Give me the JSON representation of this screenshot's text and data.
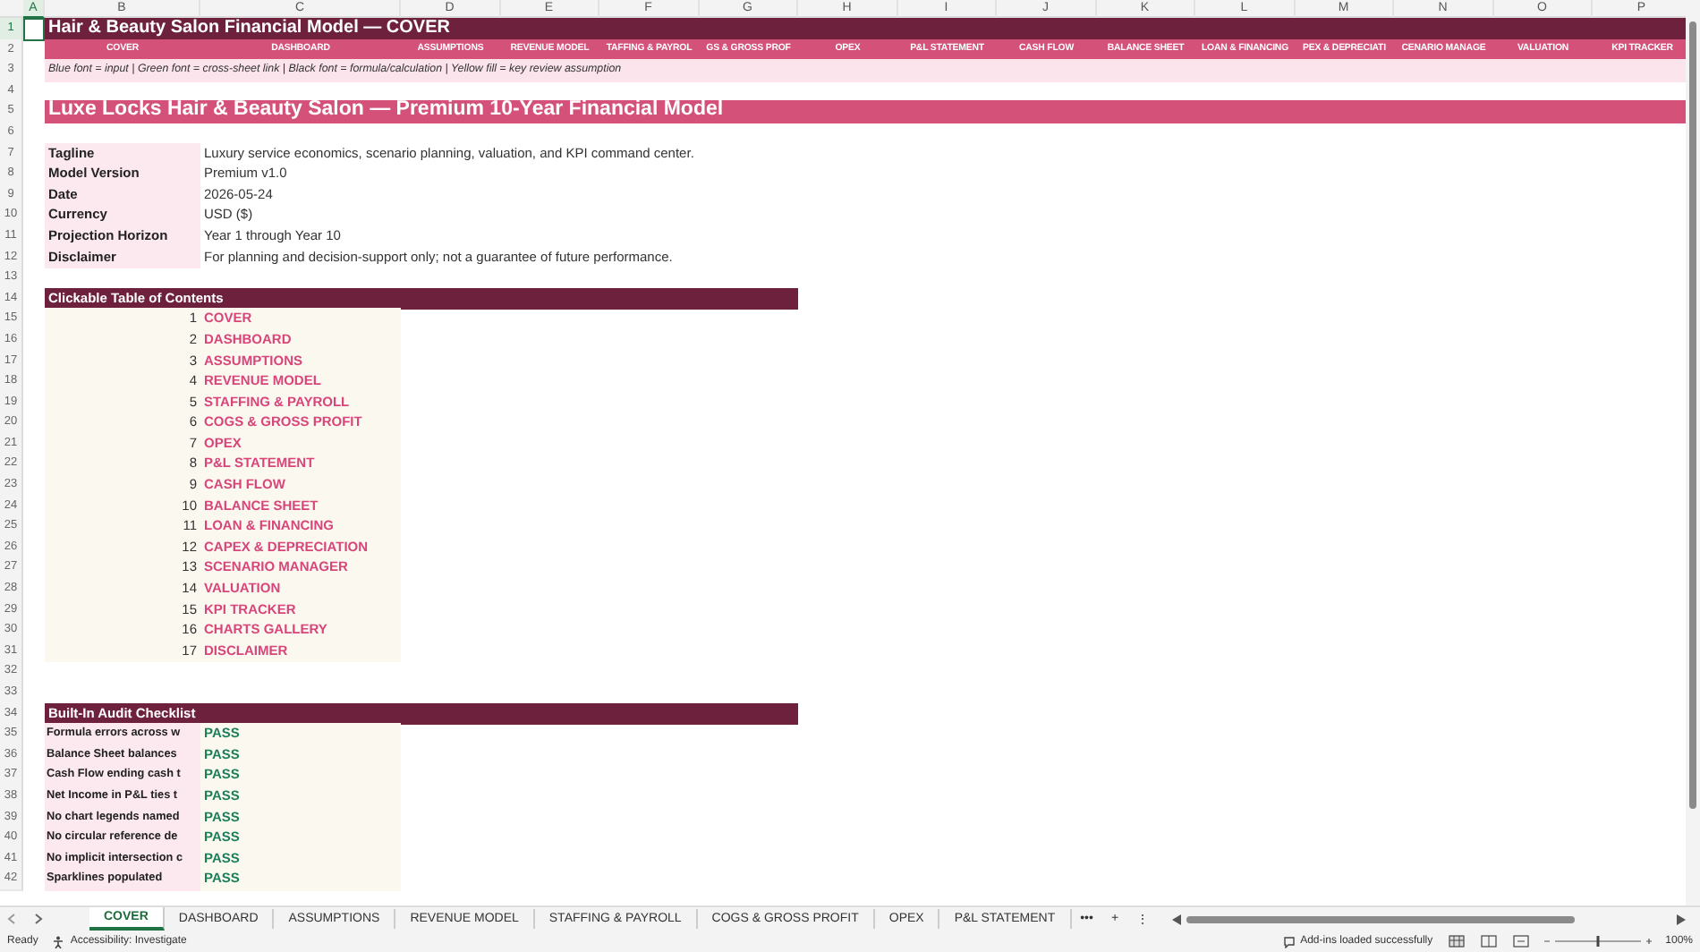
{
  "column_headers": [
    "A",
    "B",
    "C",
    "D",
    "E",
    "F",
    "G",
    "H",
    "I",
    "J",
    "K",
    "L",
    "M",
    "N",
    "O",
    "P"
  ],
  "row_numbers": [
    "1",
    "2",
    "3",
    "4",
    "5",
    "6",
    "7",
    "8",
    "9",
    "10",
    "11",
    "12",
    "13",
    "14",
    "15",
    "16",
    "17",
    "18",
    "19",
    "20",
    "21",
    "22",
    "23",
    "24",
    "25",
    "26",
    "27",
    "28",
    "29",
    "30",
    "31",
    "32",
    "33",
    "34",
    "35",
    "36",
    "37",
    "38",
    "39",
    "40",
    "41",
    "42"
  ],
  "title": "Hair & Beauty Salon Financial Model — COVER",
  "nav_links": [
    "COVER",
    "DASHBOARD",
    "ASSUMPTIONS",
    "REVENUE MODEL",
    "TAFFING & PAYROL",
    "GS & GROSS PROF",
    "OPEX",
    "P&L STATEMENT",
    "CASH FLOW",
    "BALANCE SHEET",
    "LOAN & FINANCING",
    "PEX & DEPRECIATI",
    "CENARIO MANAGE",
    "VALUATION",
    "KPI TRACKER"
  ],
  "legend": "Blue font = input | Green font = cross-sheet link | Black font = formula/calculation | Yellow fill = key review assumption",
  "banner": "Luxe Locks Hair & Beauty Salon — Premium 10-Year Financial Model",
  "details": [
    {
      "label": "Tagline",
      "value": "Luxury service economics, scenario planning, valuation, and KPI command center."
    },
    {
      "label": "Model Version",
      "value": "Premium v1.0"
    },
    {
      "label": "Date",
      "value": "2026-05-24"
    },
    {
      "label": "Currency",
      "value": "USD ($)"
    },
    {
      "label": "Projection Horizon",
      "value": "Year 1 through Year 10"
    },
    {
      "label": "Disclaimer",
      "value": "For planning and decision-support only; not a guarantee of future performance."
    }
  ],
  "toc": {
    "heading": "Clickable Table of Contents",
    "items": [
      {
        "number": "1",
        "label": "COVER"
      },
      {
        "number": "2",
        "label": "DASHBOARD"
      },
      {
        "number": "3",
        "label": "ASSUMPTIONS"
      },
      {
        "number": "4",
        "label": "REVENUE MODEL"
      },
      {
        "number": "5",
        "label": "STAFFING & PAYROLL"
      },
      {
        "number": "6",
        "label": "COGS & GROSS PROFIT"
      },
      {
        "number": "7",
        "label": "OPEX"
      },
      {
        "number": "8",
        "label": "P&L STATEMENT"
      },
      {
        "number": "9",
        "label": "CASH FLOW"
      },
      {
        "number": "10",
        "label": "BALANCE SHEET"
      },
      {
        "number": "11",
        "label": "LOAN & FINANCING"
      },
      {
        "number": "12",
        "label": "CAPEX & DEPRECIATION"
      },
      {
        "number": "13",
        "label": "SCENARIO MANAGER"
      },
      {
        "number": "14",
        "label": "VALUATION"
      },
      {
        "number": "15",
        "label": "KPI TRACKER"
      },
      {
        "number": "16",
        "label": "CHARTS GALLERY"
      },
      {
        "number": "17",
        "label": "DISCLAIMER"
      }
    ]
  },
  "audit": {
    "heading": "Built-In Audit Checklist",
    "items": [
      {
        "check": "Formula errors across w",
        "result": "PASS"
      },
      {
        "check": "Balance Sheet balances",
        "result": "PASS"
      },
      {
        "check": "Cash Flow ending cash t",
        "result": "PASS"
      },
      {
        "check": "Net Income in P&L ties t",
        "result": "PASS"
      },
      {
        "check": "No chart legends named",
        "result": "PASS"
      },
      {
        "check": "No circular reference de",
        "result": "PASS"
      },
      {
        "check": "No implicit intersection c",
        "result": "PASS"
      },
      {
        "check": "Sparklines populated",
        "result": "PASS"
      }
    ]
  },
  "sheet_tabs": [
    {
      "label": "COVER",
      "selected": true
    },
    {
      "label": "DASHBOARD",
      "selected": false
    },
    {
      "label": "ASSUMPTIONS",
      "selected": false
    },
    {
      "label": "REVENUE MODEL",
      "selected": false
    },
    {
      "label": "STAFFING & PAYROLL",
      "selected": false
    },
    {
      "label": "COGS & GROSS PROFIT",
      "selected": false
    },
    {
      "label": "OPEX",
      "selected": false
    },
    {
      "label": "P&L STATEMENT",
      "selected": false
    }
  ],
  "tab_more": "•••",
  "tab_add": "+",
  "tab_options": "⋮",
  "status_bar": {
    "ready": "Ready",
    "accessibility": "Accessibility: Investigate",
    "addins": "Add-ins loaded successfully",
    "zoom": "100%",
    "zoom_slider": {
      "level": 0.5
    }
  }
}
